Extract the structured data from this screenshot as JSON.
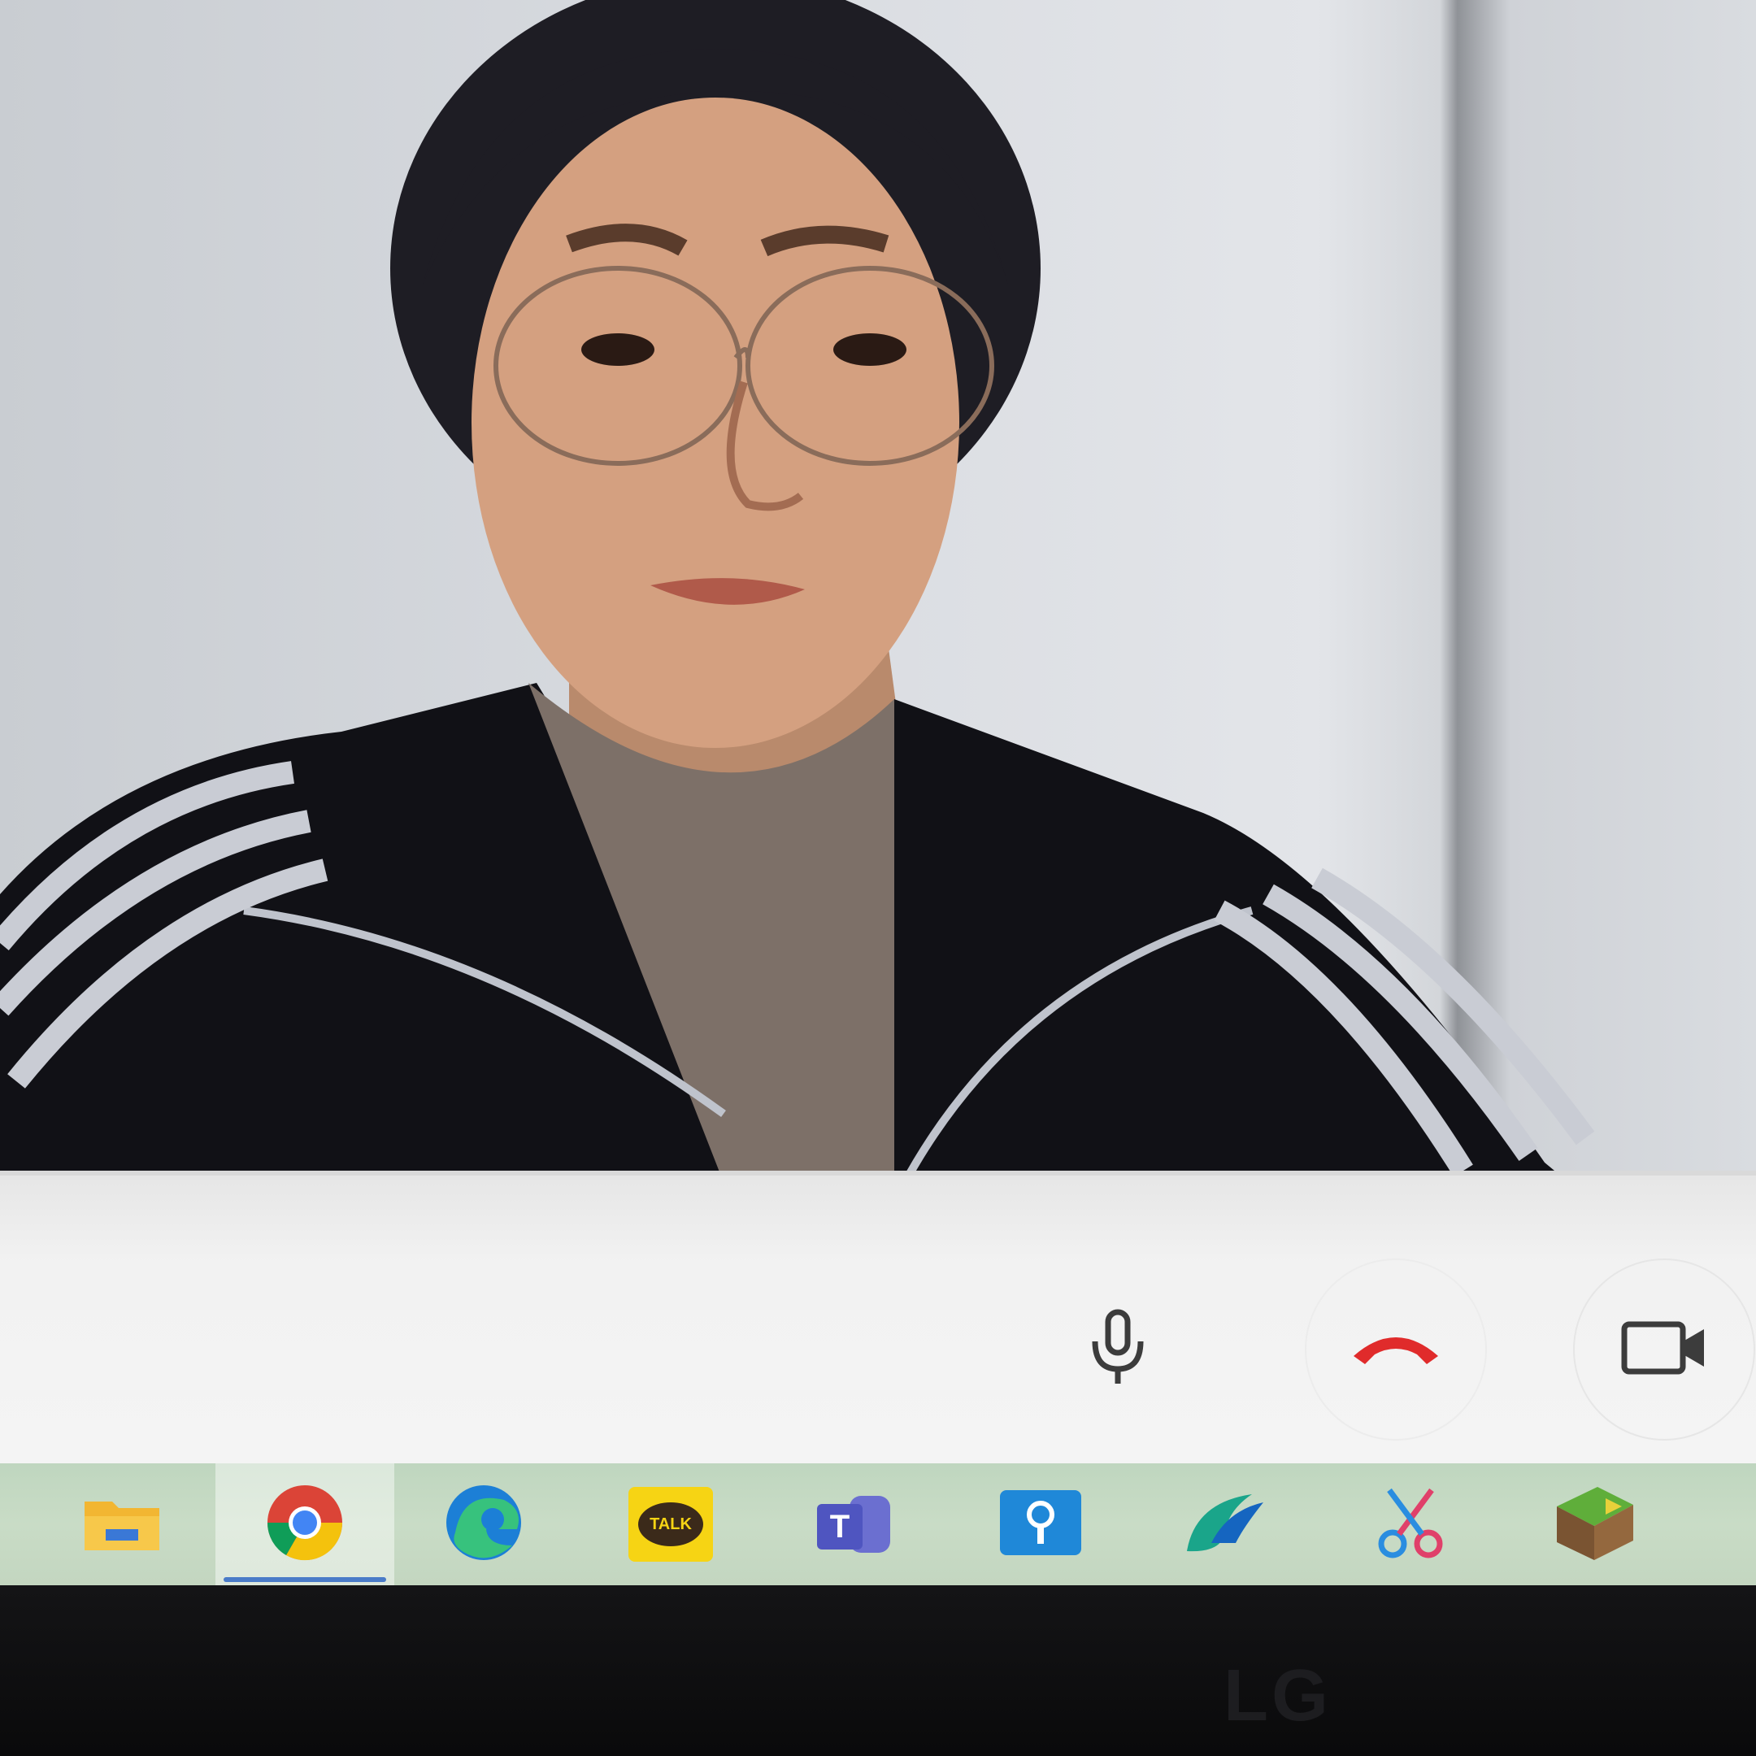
{
  "video": {
    "participant_visible": true
  },
  "call_controls": {
    "mic": {
      "icon": "microphone-icon"
    },
    "hangup": {
      "icon": "hang-up-icon",
      "color": "#e02b2b"
    },
    "camera": {
      "icon": "video-camera-icon"
    }
  },
  "taskbar": {
    "items": [
      {
        "name": "file-explorer",
        "icon": "folder-icon",
        "active": false
      },
      {
        "name": "chrome",
        "icon": "chrome-icon",
        "active": true
      },
      {
        "name": "edge",
        "icon": "edge-icon",
        "active": false
      },
      {
        "name": "kakaotalk",
        "icon": "kakaotalk-icon",
        "label": "TALK",
        "active": false
      },
      {
        "name": "teams",
        "icon": "teams-icon",
        "label": "T",
        "active": false
      },
      {
        "name": "app-blue",
        "icon": "blue-app-icon",
        "active": false
      },
      {
        "name": "app-swirl",
        "icon": "swirl-icon",
        "active": false
      },
      {
        "name": "snipping-tool",
        "icon": "scissors-icon",
        "active": false
      },
      {
        "name": "minecraft",
        "icon": "minecraft-icon",
        "active": false
      }
    ],
    "colors": {
      "active_underline": "#4a7bc8"
    }
  },
  "monitor": {
    "brand": "LG"
  }
}
